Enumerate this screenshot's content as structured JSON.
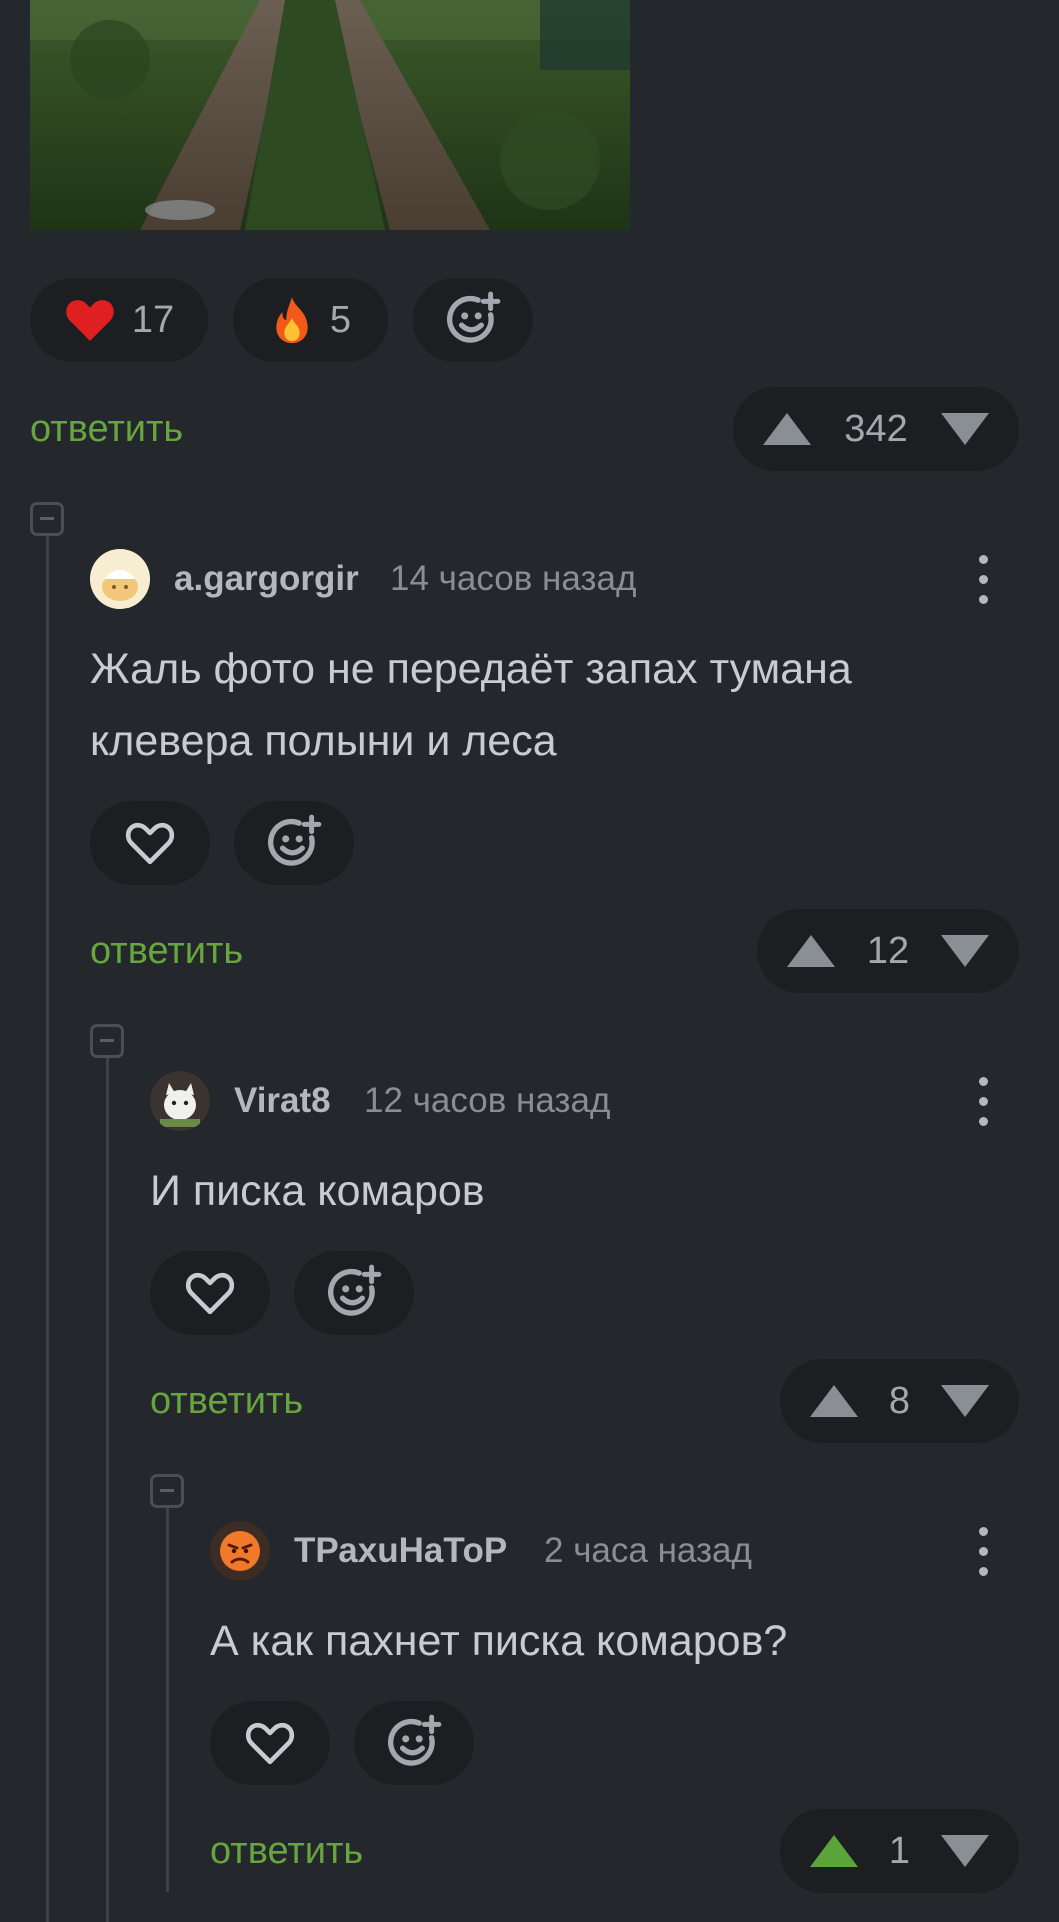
{
  "post": {
    "reactions": [
      {
        "icon": "heart-icon",
        "count": "17"
      },
      {
        "icon": "fire-icon",
        "count": "5"
      }
    ],
    "reply_label": "ответить",
    "rating": "342"
  },
  "comments": [
    {
      "author": "a.gargorgir",
      "time": "14 часов назад",
      "text_lines": [
        "Жаль фото не передаёт запах тумана",
        "клевера полыни и леса"
      ],
      "reply_label": "ответить",
      "rating": "12"
    },
    {
      "author": "Virat8",
      "time": "12 часов назад",
      "text_lines": [
        "И писка комаров"
      ],
      "reply_label": "ответить",
      "rating": "8"
    },
    {
      "author": "ТРахuНаТоР",
      "time": "2 часа назад",
      "text_lines": [
        "А как пахнет писка комаров?"
      ],
      "reply_label": "ответить",
      "rating": "1"
    }
  ],
  "colors": {
    "background": "#24272b",
    "accent_green": "#67a53f",
    "upvote_active": "#5aa43a",
    "heart_red": "#e02020"
  }
}
